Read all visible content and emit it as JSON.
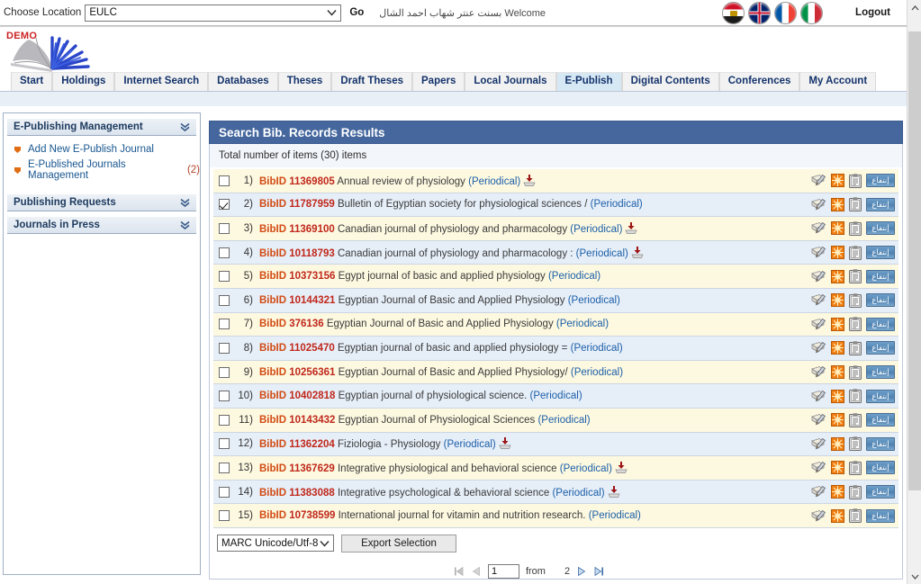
{
  "topbar": {
    "location_label": "Choose Location",
    "location_value": "EULC",
    "go_label": "Go",
    "welcome_label": "Welcome",
    "welcome_user": "بسنت عنتر شهاب احمد الشال",
    "logout_label": "Logout",
    "flags": [
      "egypt-flag",
      "uk-flag",
      "france-flag",
      "italy-flag"
    ]
  },
  "logo": {
    "demo_label": "DEMO"
  },
  "nav": {
    "tabs": [
      {
        "label": "Start",
        "active": false
      },
      {
        "label": "Holdings",
        "active": false
      },
      {
        "label": "Internet Search",
        "active": false
      },
      {
        "label": "Databases",
        "active": false
      },
      {
        "label": "Theses",
        "active": false
      },
      {
        "label": "Draft Theses",
        "active": false
      },
      {
        "label": "Papers",
        "active": false
      },
      {
        "label": "Local Journals",
        "active": false
      },
      {
        "label": "E-Publish",
        "active": true
      },
      {
        "label": "Digital Contents",
        "active": false
      },
      {
        "label": "Conferences",
        "active": false
      },
      {
        "label": "My Account",
        "active": false
      }
    ]
  },
  "sidebar": {
    "panels": [
      {
        "title": "E-Publishing Management",
        "links": [
          {
            "label": "Add New E-Publish Journal",
            "count": ""
          },
          {
            "label": "E-Published Journals Management",
            "count": "(2)"
          }
        ]
      },
      {
        "title": "Publishing Requests",
        "links": []
      },
      {
        "title": "Journals in Press",
        "links": []
      }
    ]
  },
  "results": {
    "header": "Search Bib. Records Results",
    "total_text": "Total number of items (30) items",
    "bibid_label": "BibID",
    "action_button_label": "إنتفاع",
    "row_action_icons": [
      "edit-record-icon",
      "star-icon",
      "clipboard-icon",
      "benefit-button"
    ],
    "rows": [
      {
        "index": "1)",
        "checked": false,
        "bibid": "11369805",
        "title": "Annual review of physiology",
        "type": "(Periodical)",
        "download": true
      },
      {
        "index": "2)",
        "checked": true,
        "bibid": "11787959",
        "title": "Bulletin of Egyptian society for physiological sciences /",
        "type": "(Periodical)",
        "download": false
      },
      {
        "index": "3)",
        "checked": false,
        "bibid": "11369100",
        "title": "Canadian journal of physiology and pharmacology",
        "type": "(Periodical)",
        "download": true
      },
      {
        "index": "4)",
        "checked": false,
        "bibid": "10118793",
        "title": "Canadian journal of physiology and pharmacology :",
        "type": "(Periodical)",
        "download": true
      },
      {
        "index": "5)",
        "checked": false,
        "bibid": "10373156",
        "title": "Egypt journal of basic and applied physiology",
        "type": "(Periodical)",
        "download": false
      },
      {
        "index": "6)",
        "checked": false,
        "bibid": "10144321",
        "title": "Egyptian Journal of Basic and Applied Physiology",
        "type": "(Periodical)",
        "download": false
      },
      {
        "index": "7)",
        "checked": false,
        "bibid": "376136",
        "title": "Egyptian Journal of Basic and Applied Physiology",
        "type": "(Periodical)",
        "download": false
      },
      {
        "index": "8)",
        "checked": false,
        "bibid": "11025470",
        "title": "Egyptian journal of basic and applied physiology =",
        "type": "(Periodical)",
        "download": false
      },
      {
        "index": "9)",
        "checked": false,
        "bibid": "10256361",
        "title": "Egyptian Journal of Basic and Applied Physiology/",
        "type": "(Periodical)",
        "download": false
      },
      {
        "index": "10)",
        "checked": false,
        "bibid": "10402818",
        "title": "Egyptian journal of physiological science.",
        "type": "(Periodical)",
        "download": false
      },
      {
        "index": "11)",
        "checked": false,
        "bibid": "10143432",
        "title": "Egyptian Journal of Physiological Sciences",
        "type": "(Periodical)",
        "download": false
      },
      {
        "index": "12)",
        "checked": false,
        "bibid": "11362204",
        "title": "Fiziologia - Physiology",
        "type": "(Periodical)",
        "download": true
      },
      {
        "index": "13)",
        "checked": false,
        "bibid": "11367629",
        "title": "Integrative physiological and behavioral science",
        "type": "(Periodical)",
        "download": true
      },
      {
        "index": "14)",
        "checked": false,
        "bibid": "11383088",
        "title": "Integrative psychological & behavioral science",
        "type": "(Periodical)",
        "download": true
      },
      {
        "index": "15)",
        "checked": false,
        "bibid": "10738599",
        "title": "International journal for vitamin and nutrition research.",
        "type": "(Periodical)",
        "download": false
      }
    ]
  },
  "export": {
    "format_value": "MARC Unicode/Utf-8",
    "button_label": "Export Selection"
  },
  "pagination": {
    "first_icon": "first-page-icon",
    "prev_icon": "previous-page-icon",
    "current_page": "1",
    "from_label": "from",
    "total_pages": "2",
    "next_icon": "next-page-icon",
    "last_icon": "last-page-icon"
  },
  "colors": {
    "header_blue": "#45679e",
    "tab_active": "#d7e8f5",
    "row_odd": "#fdf8e0",
    "row_even": "#e6eef8",
    "bibid_orange": "#d24a12",
    "bibnum_red": "#c0281b",
    "link_blue": "#18568f"
  }
}
